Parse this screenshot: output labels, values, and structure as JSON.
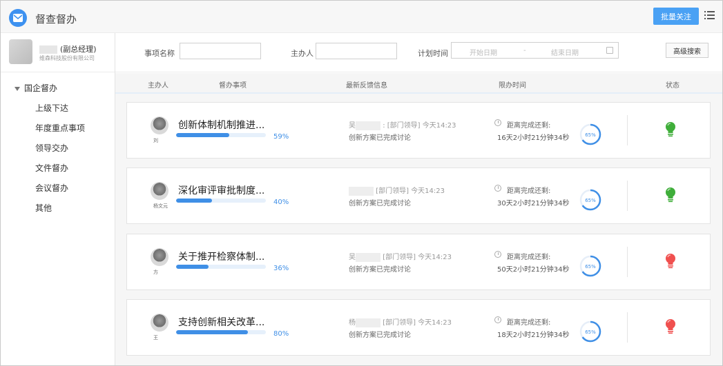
{
  "header": {
    "title": "督查督办",
    "batch_button": "批量关注"
  },
  "user": {
    "name_suffix": "(副总经理)",
    "company": "维森科技股份有限公司"
  },
  "nav": {
    "group": "国企督办",
    "items": [
      "上级下达",
      "年度重点事项",
      "领导交办",
      "文件督办",
      "会议督办",
      "其他"
    ]
  },
  "filters": {
    "item_name_label": "事项名称",
    "owner_label": "主办人",
    "plan_time_label": "计划时间",
    "start_placeholder": "开始日期",
    "date_separator": "-",
    "end_placeholder": "结束日期",
    "advanced_search": "高级搜索"
  },
  "table_header": {
    "owner": "主办人",
    "item": "督办事项",
    "feedback": "最新反馈信息",
    "deadline": "限办时间",
    "status": "状态"
  },
  "rows": [
    {
      "owner": "刘",
      "title": "创新体制机制推进...",
      "progress_pct": 59,
      "progress_text": "59%",
      "feedback_name": "吴",
      "feedback_meta": ":  [部门领导] 今天14:23",
      "feedback_text": "创新方案已完成讨论",
      "remain_label": "距离完成还剩:",
      "remain": "16天2小时21分钟34秒",
      "ring_text": "65%",
      "ring_pct": 65,
      "status_color": "#3fae3a"
    },
    {
      "owner": "杨文元",
      "title": "深化审评审批制度...",
      "progress_pct": 40,
      "progress_text": "40%",
      "feedback_name": "",
      "feedback_meta": "[部门领导] 今天14:23",
      "feedback_text": "创新方案已完成讨论",
      "remain_label": "距离完成还剩:",
      "remain": "30天2小时21分钟34秒",
      "ring_text": "65%",
      "ring_pct": 65,
      "status_color": "#3fae3a"
    },
    {
      "owner": "方",
      "title": "关于推开检察体制...",
      "progress_pct": 36,
      "progress_text": "36%",
      "feedback_name": "吴",
      "feedback_meta": "[部门领导] 今天14:23",
      "feedback_text": "创新方案已完成讨论",
      "remain_label": "距离完成还剩:",
      "remain": "50天2小时21分钟34秒",
      "ring_text": "65%",
      "ring_pct": 65,
      "status_color": "#f0504f"
    },
    {
      "owner": "王",
      "title": "支持创新相关改革...",
      "progress_pct": 80,
      "progress_text": "80%",
      "feedback_name": "杨",
      "feedback_meta": "[部门领导] 今天14:23",
      "feedback_text": "创新方案已完成讨论",
      "remain_label": "距离完成还剩:",
      "remain": "18天2小时21分钟34秒",
      "ring_text": "65%",
      "ring_pct": 65,
      "status_color": "#f0504f"
    }
  ]
}
